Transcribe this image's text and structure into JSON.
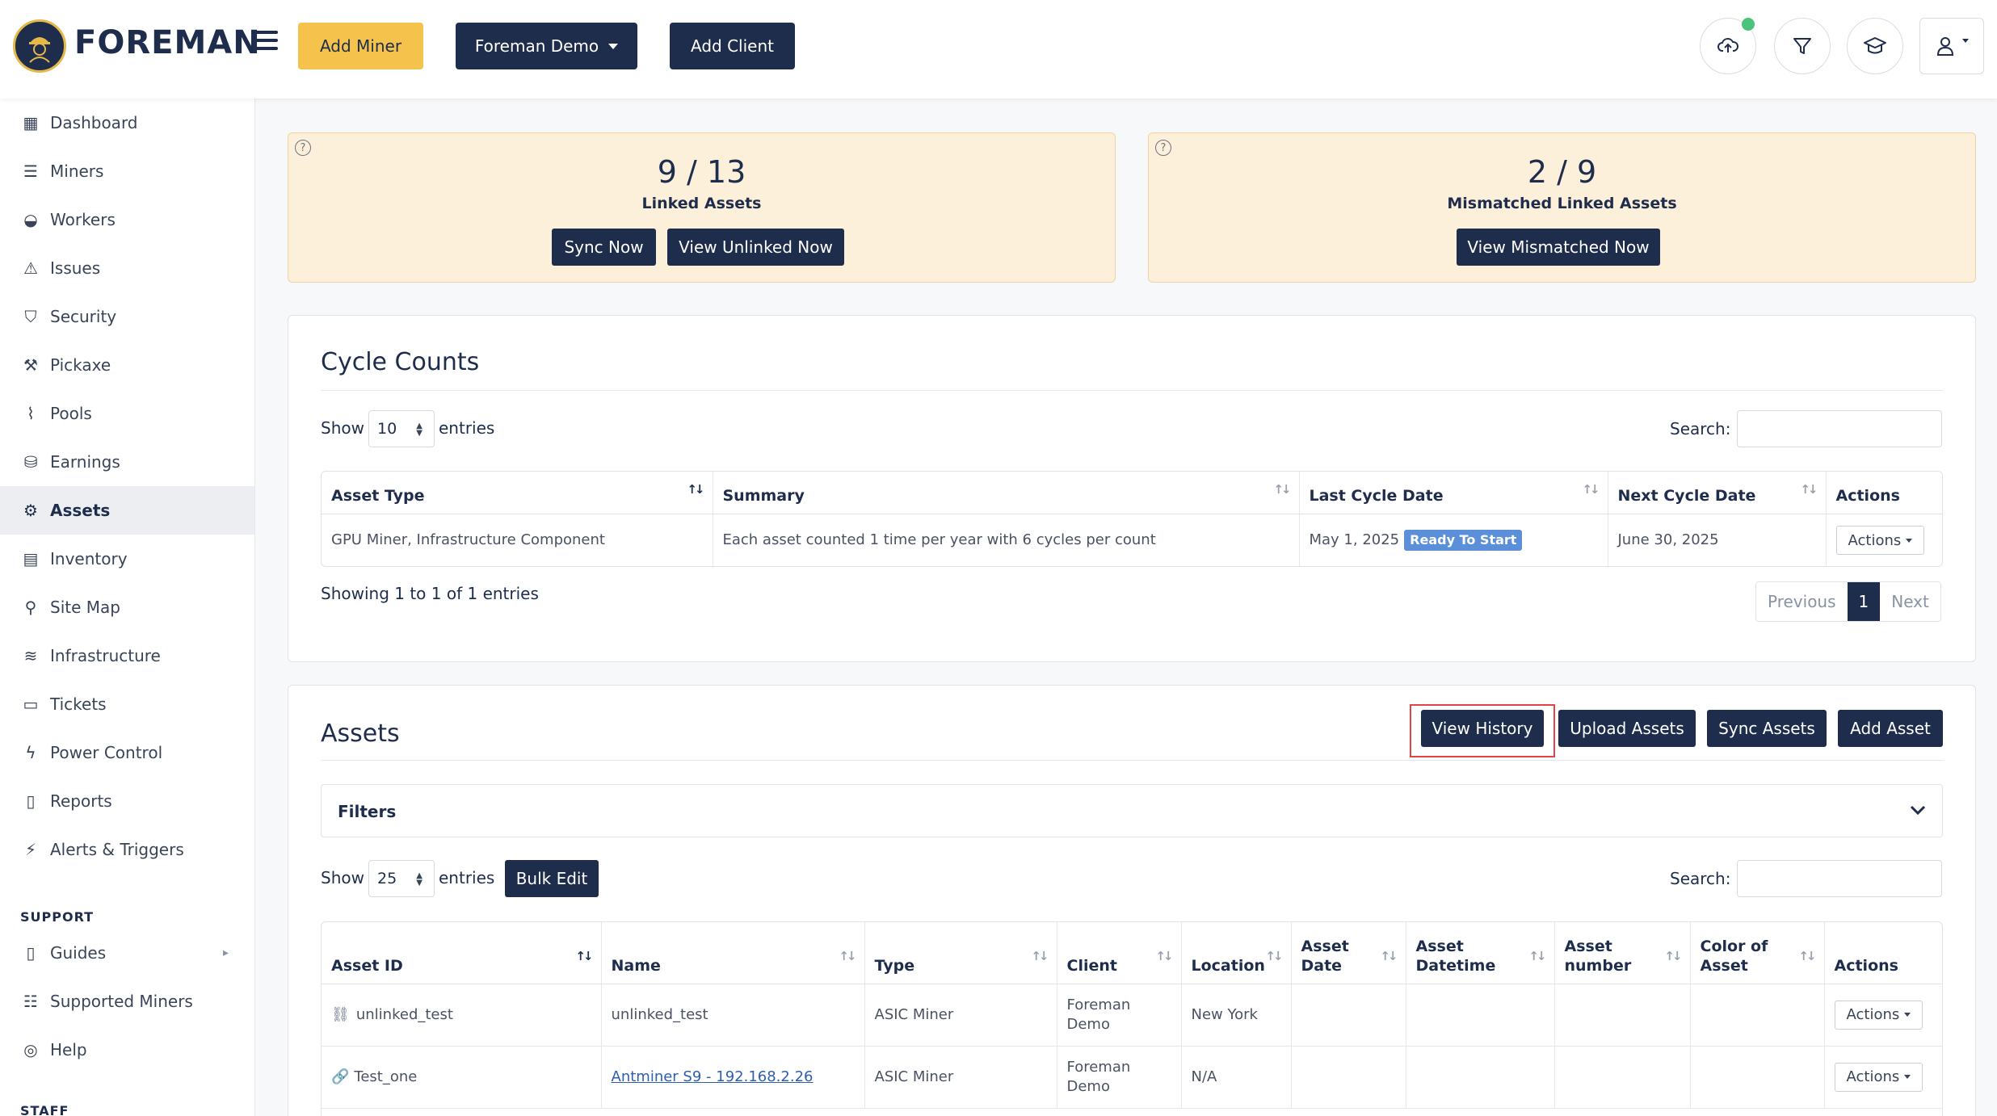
{
  "header": {
    "brand": "FOREMAN",
    "add_miner": "Add Miner",
    "org_select": "Foreman Demo",
    "add_client": "Add Client"
  },
  "sidebar": {
    "items": [
      {
        "label": "Dashboard",
        "icon": "dashboard-icon"
      },
      {
        "label": "Miners",
        "icon": "server-icon"
      },
      {
        "label": "Workers",
        "icon": "worker-icon"
      },
      {
        "label": "Issues",
        "icon": "warning-icon"
      },
      {
        "label": "Security",
        "icon": "shield-icon"
      },
      {
        "label": "Pickaxe",
        "icon": "pickaxe-icon"
      },
      {
        "label": "Pools",
        "icon": "pools-icon"
      },
      {
        "label": "Earnings",
        "icon": "earnings-icon"
      },
      {
        "label": "Assets",
        "icon": "gear-icon"
      },
      {
        "label": "Inventory",
        "icon": "inventory-icon"
      },
      {
        "label": "Site Map",
        "icon": "sitemap-icon"
      },
      {
        "label": "Infrastructure",
        "icon": "layers-icon"
      },
      {
        "label": "Tickets",
        "icon": "ticket-icon"
      },
      {
        "label": "Power Control",
        "icon": "bolt-icon"
      },
      {
        "label": "Reports",
        "icon": "report-icon"
      },
      {
        "label": "Alerts & Triggers",
        "icon": "alert-icon"
      }
    ],
    "support_heading": "SUPPORT",
    "support_items": [
      {
        "label": "Guides",
        "icon": "book-icon"
      },
      {
        "label": "Supported Miners",
        "icon": "list-icon"
      },
      {
        "label": "Help",
        "icon": "help-icon"
      }
    ],
    "staff_heading": "STAFF"
  },
  "stats": {
    "linked": {
      "value": "9 / 13",
      "label": "Linked Assets",
      "sync": "Sync Now",
      "view": "View Unlinked Now"
    },
    "mismatched": {
      "value": "2 / 9",
      "label": "Mismatched Linked Assets",
      "view": "View Mismatched Now"
    },
    "help": "?"
  },
  "cycle": {
    "title": "Cycle Counts",
    "show": "Show",
    "entries": "entries",
    "page_size": "10",
    "search": "Search:",
    "columns": [
      "Asset Type",
      "Summary",
      "Last Cycle Date",
      "Next Cycle Date",
      "Actions"
    ],
    "row": {
      "asset_type": "GPU Miner, Infrastructure Component",
      "summary": "Each asset counted 1 time per year with 6 cycles per count",
      "last_cycle": "May 1, 2025",
      "status": "Ready To Start",
      "next_cycle": "June 30, 2025",
      "actions": "Actions"
    },
    "showing": "Showing 1 to 1 of 1 entries",
    "prev": "Previous",
    "page": "1",
    "next": "Next"
  },
  "assets": {
    "title": "Assets",
    "view_history": "View History",
    "upload": "Upload Assets",
    "sync": "Sync Assets",
    "add": "Add Asset",
    "filters": "Filters",
    "show": "Show",
    "entries": "entries",
    "page_size": "25",
    "bulk_edit": "Bulk Edit",
    "search": "Search:",
    "columns": [
      "Asset ID",
      "Name",
      "Type",
      "Client",
      "Location",
      "Asset Date",
      "Asset Datetime",
      "Asset number",
      "Color of Asset",
      "Actions"
    ],
    "rows": [
      {
        "id": "unlinked_test",
        "name": "unlinked_test",
        "type": "ASIC Miner",
        "client": "Foreman Demo",
        "location": "New York",
        "actions": "Actions"
      },
      {
        "id": "Test_one",
        "name": "Antminer S9 - 192.168.2.26",
        "type": "ASIC Miner",
        "client": "Foreman Demo",
        "location": "N/A",
        "actions": "Actions"
      }
    ]
  }
}
